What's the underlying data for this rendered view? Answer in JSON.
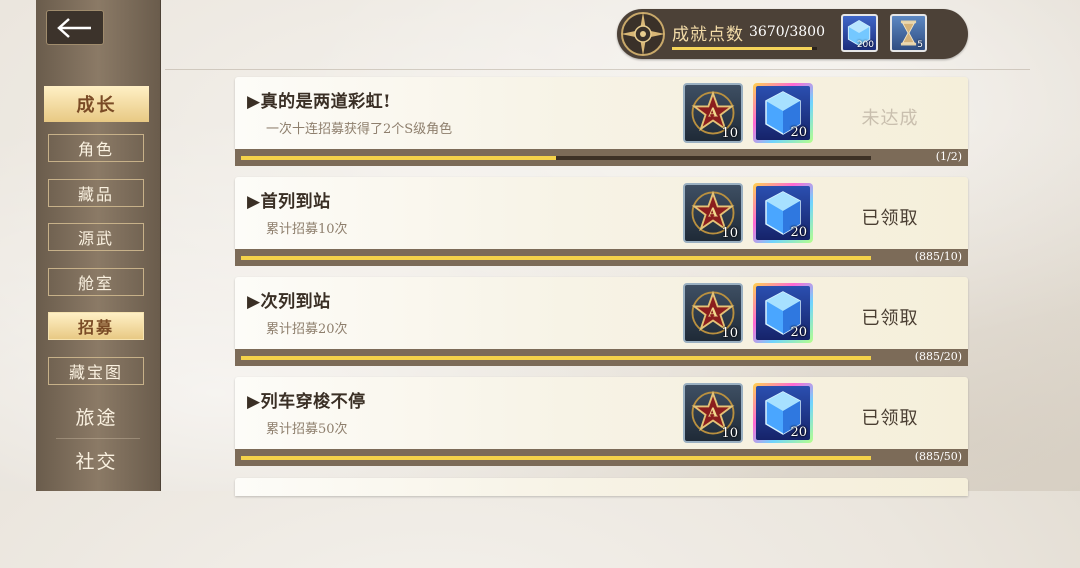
{
  "sidebar": {
    "back_icon": "back-arrow-icon",
    "items": [
      {
        "label": "成长",
        "active": true
      },
      {
        "label": "角色"
      },
      {
        "label": "藏品"
      },
      {
        "label": "源武"
      },
      {
        "label": "舱室"
      },
      {
        "label": "招募",
        "active": true
      },
      {
        "label": "藏宝图"
      },
      {
        "label": "旅途"
      },
      {
        "label": "社交"
      }
    ]
  },
  "header": {
    "score_label": "成就点数",
    "score_value": "3670/3800",
    "score_progress": 0.966,
    "currency": [
      {
        "icon": "blue-crystal-icon",
        "count": "200"
      },
      {
        "icon": "hourglass-icon",
        "count": "5"
      }
    ]
  },
  "achievements": [
    {
      "title": "▶真的是两道彩虹!",
      "desc": "一次十连招募获得了2个S级角色",
      "reward_a": "10",
      "reward_b": "20",
      "status": "未达成",
      "progress_text": "(1/2)",
      "progress": 0.5
    },
    {
      "title": "▶首列到站",
      "desc": "累计招募10次",
      "reward_a": "10",
      "reward_b": "20",
      "status": "已领取",
      "progress_text": "(885/10)",
      "progress": 1
    },
    {
      "title": "▶次列到站",
      "desc": "累计招募20次",
      "reward_a": "10",
      "reward_b": "20",
      "status": "已领取",
      "progress_text": "(885/20)",
      "progress": 1
    },
    {
      "title": "▶列车穿梭不停",
      "desc": "累计招募50次",
      "reward_a": "10",
      "reward_b": "20",
      "status": "已领取",
      "progress_text": "(885/50)",
      "progress": 1
    }
  ],
  "colors": {
    "accent_gold": "#f4d24a",
    "sidebar": "#7a6a57"
  }
}
